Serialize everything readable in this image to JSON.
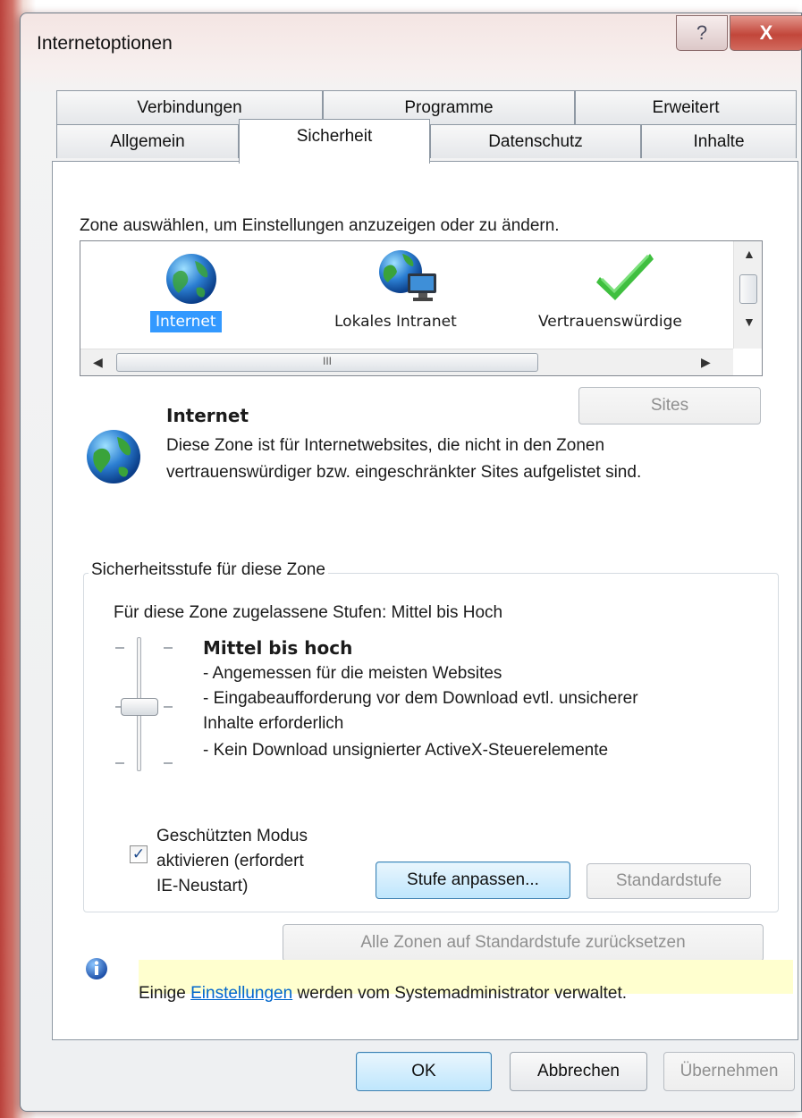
{
  "window": {
    "title": "Internetoptionen",
    "help_glyph": "?",
    "close_glyph": "X"
  },
  "tabs": {
    "row1": [
      "Verbindungen",
      "Programme",
      "Erweitert"
    ],
    "row2": [
      "Allgemein",
      "Sicherheit",
      "Datenschutz",
      "Inhalte"
    ],
    "active": "Sicherheit"
  },
  "zones": {
    "prompt": "Zone auswählen, um Einstellungen anzuzeigen oder zu ändern.",
    "items": [
      {
        "label": "Internet",
        "icon": "globe-icon",
        "selected": true
      },
      {
        "label": "Lokales Intranet",
        "icon": "intranet-icon",
        "selected": false
      },
      {
        "label": "Vertrauenswürdige",
        "icon": "checkmark-icon",
        "selected": false
      }
    ],
    "hscroll_thumb_label": "III"
  },
  "zone_detail": {
    "sites_button": "Sites",
    "title": "Internet",
    "desc_line1": "Diese Zone ist für Internetwebsites, die nicht in den Zonen",
    "desc_line2": "vertrauenswürdiger bzw. eingeschränkter Sites aufgelistet sind."
  },
  "security_level": {
    "group_title": "Sicherheitsstufe für diese Zone",
    "allowed": "Für diese Zone zugelassene Stufen: Mittel bis Hoch",
    "level_name": "Mittel bis hoch",
    "line1": "- Angemessen für die meisten Websites",
    "line2": "- Eingabeaufforderung vor dem Download evtl. unsicherer",
    "line3": "Inhalte erforderlich",
    "line4": "- Kein Download unsignierter ActiveX-Steuerelemente",
    "slider_level": 2,
    "slider_steps": 4,
    "protected_mode_checked": true,
    "checkmark": "✓",
    "protected_mode_line1": "Geschützten Modus",
    "protected_mode_line2": "aktivieren (erfordert",
    "protected_mode_line3": "IE-Neustart)",
    "custom_level_button": "Stufe anpassen...",
    "default_level_button": "Standardstufe"
  },
  "reset_all_button": "Alle Zonen auf Standardstufe zurücksetzen",
  "admin_notice": {
    "prefix": "Einige",
    "link": "Einstellungen",
    "suffix": "werden vom Systemadministrator verwaltet."
  },
  "footer": {
    "ok": "OK",
    "cancel": "Abbrechen",
    "apply": "Übernehmen"
  },
  "colors": {
    "selection": "#3399ff",
    "link": "#0066cc",
    "info_bar": "#ffffcf",
    "close_button": "#c2463a"
  }
}
